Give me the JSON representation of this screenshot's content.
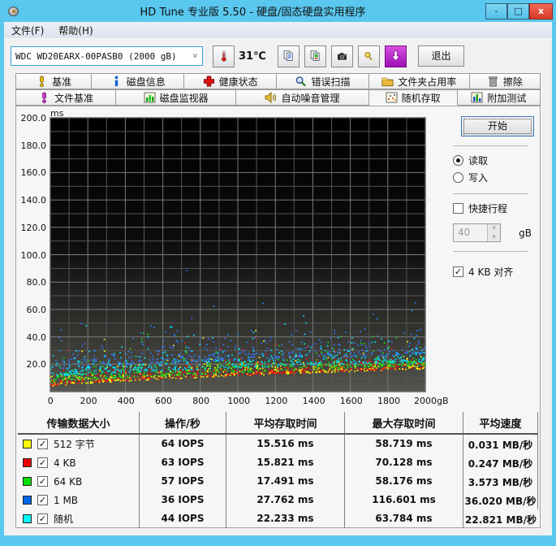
{
  "window": {
    "title": "HD Tune 专业版 5.50 - 硬盘/固态硬盘实用程序",
    "controls": {
      "minimize": "-",
      "maximize": "□",
      "close": "x"
    }
  },
  "menu": {
    "items": [
      {
        "label": "文件(F)"
      },
      {
        "label": "帮助(H)"
      }
    ]
  },
  "toolbar": {
    "drive_select": {
      "value": "WDC WD20EARX-00PASB0 (2000 gB)",
      "chevron": "v"
    },
    "temperature": "31℃",
    "icons": [
      "thermometer-icon",
      "copy-text-icon",
      "copy-image-icon",
      "screenshot-icon",
      "options-icon",
      "update-icon"
    ],
    "exit_label": "退出"
  },
  "tabs": {
    "row1": [
      {
        "label": "基准",
        "icon": "benchmark-icon"
      },
      {
        "label": "磁盘信息",
        "icon": "disk-info-icon"
      },
      {
        "label": "健康状态",
        "icon": "health-icon"
      },
      {
        "label": "错误扫描",
        "icon": "error-scan-icon"
      },
      {
        "label": "文件夹占用率",
        "icon": "folder-usage-icon"
      },
      {
        "label": "擦除",
        "icon": "erase-icon"
      }
    ],
    "row2": [
      {
        "label": "文件基准",
        "icon": "file-benchmark-icon"
      },
      {
        "label": "磁盘监视器",
        "icon": "disk-monitor-icon"
      },
      {
        "label": "自动噪音管理",
        "icon": "aam-icon"
      },
      {
        "label": "随机存取",
        "icon": "random-access-icon"
      },
      {
        "label": "附加测试",
        "icon": "extra-tests-icon"
      }
    ],
    "active": "随机存取"
  },
  "controls": {
    "start_label": "开始",
    "read_label": "读取",
    "write_label": "写入",
    "mode_selected": "read",
    "short_stroke_label": "快捷行程",
    "short_stroke_checked": false,
    "short_stroke_value": "40",
    "short_stroke_unit": "gB",
    "align_label": "4 KB 对齐",
    "align_checked": true,
    "check_glyph": "✓"
  },
  "chart_data": {
    "type": "scatter",
    "title": "随机存取延迟散点图 (random access latency)",
    "y_unit": "ms",
    "x_unit": "gB",
    "xlim": [
      0,
      2000
    ],
    "ylim": [
      0,
      200
    ],
    "x_tick_labels": [
      "0",
      "200",
      "400",
      "600",
      "800",
      "1000",
      "1200",
      "1400",
      "1600",
      "1800",
      "2000gB"
    ],
    "y_tick_labels": [
      "200.0",
      "180.0",
      "160.0",
      "140.0",
      "120.0",
      "100.0",
      "80.0",
      "60.0",
      "40.0",
      "20.0"
    ],
    "grid": true,
    "plot_bg_top": "#000000",
    "plot_bg_bottom": "#55554e",
    "grid_major_color": "#7a7a7a",
    "grid_minor_color": "#565656",
    "series": [
      {
        "name": "512 字节",
        "color": "#ffff00",
        "iops": 64,
        "avg_ms": 15.516,
        "max_ms": 58.719,
        "avg_speed_mb_s": 0.031,
        "gen": {
          "seed": 11,
          "count": 420,
          "b0": 3.5,
          "b1": 13,
          "spread": 4.2,
          "tail_p": 0.008,
          "tail_add": 40
        }
      },
      {
        "name": "4 KB",
        "color": "#ee1111",
        "iops": 63,
        "avg_ms": 15.821,
        "max_ms": 70.128,
        "avg_speed_mb_s": 0.247,
        "gen": {
          "seed": 22,
          "count": 420,
          "b0": 4.0,
          "b1": 13,
          "spread": 4.2,
          "tail_p": 0.008,
          "tail_add": 52
        }
      },
      {
        "name": "64 KB",
        "color": "#17dd17",
        "iops": 57,
        "avg_ms": 17.491,
        "max_ms": 58.176,
        "avg_speed_mb_s": 3.573,
        "gen": {
          "seed": 33,
          "count": 420,
          "b0": 5.5,
          "b1": 13.5,
          "spread": 4.6,
          "tail_p": 0.008,
          "tail_add": 38
        }
      },
      {
        "name": "1 MB",
        "color": "#2f7cff",
        "iops": 36,
        "avg_ms": 27.762,
        "max_ms": 116.601,
        "avg_speed_mb_s": 36.02,
        "gen": {
          "seed": 44,
          "count": 420,
          "b0": 16,
          "b1": 11,
          "spread": 7.5,
          "tail_p": 0.012,
          "tail_add": 55
        }
      },
      {
        "name": "随机",
        "color": "#00e8ff",
        "iops": 44,
        "avg_ms": 22.233,
        "max_ms": 63.784,
        "avg_speed_mb_s": 22.821,
        "gen": {
          "seed": 55,
          "count": 420,
          "b0": 10.5,
          "b1": 11,
          "spread": 5.5,
          "tail_p": 0.01,
          "tail_add": 35
        }
      }
    ]
  },
  "table": {
    "headers": [
      "传输数据大小",
      "操作/秒",
      "平均存取时间",
      "最大存取时间",
      "平均速度"
    ],
    "rows": [
      {
        "color": "#ffff00",
        "checked": true,
        "label": "512 字节",
        "iops": "64 IOPS",
        "avg": "15.516 ms",
        "max": "58.719 ms",
        "speed": "0.031 MB/秒"
      },
      {
        "color": "#ee0000",
        "checked": true,
        "label": "4 KB",
        "iops": "63 IOPS",
        "avg": "15.821 ms",
        "max": "70.128 ms",
        "speed": "0.247 MB/秒"
      },
      {
        "color": "#00dd00",
        "checked": true,
        "label": "64 KB",
        "iops": "57 IOPS",
        "avg": "17.491 ms",
        "max": "58.176 ms",
        "speed": "3.573 MB/秒"
      },
      {
        "color": "#0066eb",
        "checked": true,
        "label": "1 MB",
        "iops": "36 IOPS",
        "avg": "27.762 ms",
        "max": "116.601 ms",
        "speed": "36.020 MB/秒"
      },
      {
        "color": "#00ffff",
        "checked": true,
        "label": "随机",
        "iops": "44 IOPS",
        "avg": "22.233 ms",
        "max": "63.784 ms",
        "speed": "22.821 MB/秒"
      }
    ]
  }
}
